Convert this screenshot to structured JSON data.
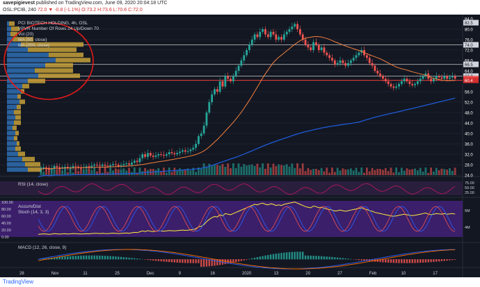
{
  "header": {
    "user": "savepigievest",
    "published": " published on TradingView.com, June 09, 2020 20:04:18 UTC",
    "symbol": "OSL:PCIB, 240",
    "quote": "72.0 ▼ -0.8 (-1.1%) O:73.2 H:73.6 L:70.6 C:72.0"
  },
  "legend": [
    "PCI BIOTECH HOLDING, 4h, OSL",
    "VPVR Number Of Rows 24 Up/Down 70",
    "Vol (20)",
    "MA (50, close)",
    "MA (200, close)"
  ],
  "price_labels": [
    {
      "text": "84.0",
      "value": 84,
      "color": "#ffffff"
    },
    {
      "text": "82.5",
      "value": 82.5,
      "color": "#ffffff",
      "box": true
    },
    {
      "text": "80.0",
      "value": 80,
      "color": "#ffffff"
    },
    {
      "text": "76.0",
      "value": 76,
      "color": "#ffffff"
    },
    {
      "text": "74.0",
      "value": 74,
      "color": "#ffffff",
      "box": true
    },
    {
      "text": "72.0",
      "value": 72,
      "color": "#ffffff"
    },
    {
      "text": "68.0",
      "value": 68,
      "color": "#ffffff"
    },
    {
      "text": "66.5",
      "value": 66.5,
      "color": "#ffffff",
      "box": true
    },
    {
      "text": "64.0",
      "value": 64,
      "color": "#ffffff"
    },
    {
      "text": "62.0",
      "value": 62,
      "color": "#ffffff",
      "box": true
    },
    {
      "text": "61.0",
      "value": 61,
      "color": "#ffffff",
      "box": "#ef5350"
    },
    {
      "text": "60.4",
      "value": 60.4,
      "color": "#ffffff",
      "box": "#d32f2f"
    },
    {
      "text": "56.0",
      "value": 56,
      "color": "#ffffff"
    },
    {
      "text": "52.0",
      "value": 52,
      "color": "#ffffff"
    },
    {
      "text": "48.0",
      "value": 48,
      "color": "#ffffff"
    },
    {
      "text": "44.0",
      "value": 44,
      "color": "#ffffff"
    },
    {
      "text": "40.0",
      "value": 40,
      "color": "#ffffff"
    },
    {
      "text": "36.0",
      "value": 36,
      "color": "#ffffff"
    },
    {
      "text": "32.0",
      "value": 32,
      "color": "#ffffff"
    },
    {
      "text": "28.0",
      "value": 28,
      "color": "#ffffff"
    },
    {
      "text": "24.0",
      "value": 24,
      "color": "#ffffff"
    }
  ],
  "rsi": {
    "label": "RSI (14, close)",
    "ticks": [
      "75.00",
      "50.00",
      "25.00"
    ]
  },
  "accum": {
    "label": "Accum/Dist",
    "label2": "Stoch (14, 3, 3)",
    "ticks": [
      "100.00",
      "80.00",
      "60.00",
      "40.00",
      "20.00",
      "0.00"
    ],
    "right": [
      "5M",
      "4M"
    ]
  },
  "macd": {
    "label": "MACD (12, 26, close, 9)"
  },
  "x_ticks": [
    "28",
    "Nov",
    "11",
    "25",
    "Dec",
    "9",
    "16",
    "2020",
    "13",
    "20",
    "27",
    "Feb",
    "10",
    "17"
  ],
  "footer": {
    "logo": "TradingView"
  },
  "colors": {
    "up": "#26a69a",
    "down": "#ef5350",
    "ma50": "#f5813f",
    "ma200": "#1e5bd8",
    "vpvr_up": "#2f6fb3",
    "vpvr_down": "#c7a13a",
    "circle": "#e31b1b"
  }
}
